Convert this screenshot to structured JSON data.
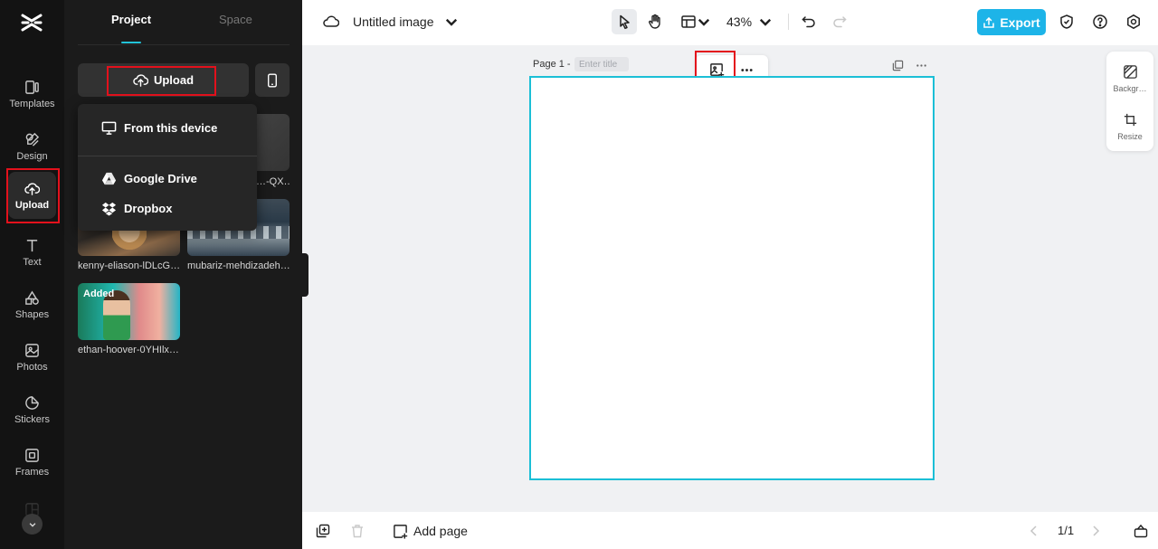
{
  "rail": {
    "items": [
      {
        "label": "Templates",
        "icon": "templates-icon"
      },
      {
        "label": "Design",
        "icon": "design-icon"
      },
      {
        "label": "Upload",
        "icon": "upload-cloud-icon"
      },
      {
        "label": "Text",
        "icon": "text-icon"
      },
      {
        "label": "Shapes",
        "icon": "shapes-icon"
      },
      {
        "label": "Photos",
        "icon": "photos-icon"
      },
      {
        "label": "Stickers",
        "icon": "stickers-icon"
      },
      {
        "label": "Frames",
        "icon": "frames-icon"
      }
    ],
    "active": "Upload"
  },
  "panel": {
    "tabs": [
      {
        "label": "Project"
      },
      {
        "label": "Space"
      }
    ],
    "upload_label": "Upload",
    "upload_menu": [
      {
        "label": "From this device",
        "icon": "monitor-icon"
      },
      {
        "label": "Google Drive",
        "icon": "google-drive-icon"
      },
      {
        "label": "Dropbox",
        "icon": "dropbox-icon"
      }
    ],
    "assets": [
      {
        "label": "",
        "partial_label": "…-QX…"
      },
      {
        "label": "kenny-eliason-lDLcG…"
      },
      {
        "label": "mubariz-mehdizadeh…"
      },
      {
        "label": "ethan-hoover-0YHIlx…",
        "badge": "Added"
      }
    ]
  },
  "header": {
    "title": "Untitled image",
    "zoom": "43%",
    "export_label": "Export"
  },
  "canvas": {
    "page_label": "Page 1 -",
    "title_placeholder": "Enter title"
  },
  "right_panel": {
    "items": [
      {
        "label": "Backgr…"
      },
      {
        "label": "Resize"
      }
    ]
  },
  "bottom": {
    "add_page_label": "Add page",
    "pager": "1/1"
  },
  "colors": {
    "accent": "#1db4e8",
    "artboard_border": "#1bbfd6",
    "highlight": "#e3111c"
  }
}
